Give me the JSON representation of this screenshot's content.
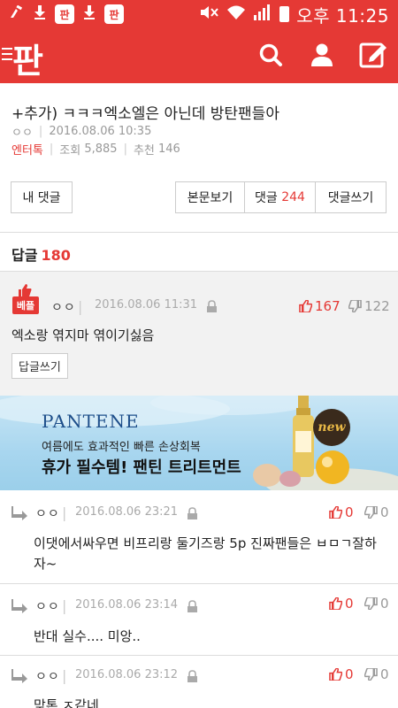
{
  "status_bar": {
    "app_badge_1": "판",
    "app_badge_2": "판",
    "time": "오후 11:25"
  },
  "header": {
    "logo": "판"
  },
  "post": {
    "title": "+추가) ㅋㅋㅋ엑소엘은 아닌데 방탄팬들아",
    "author": "ㅇㅇ",
    "datetime": "2016.08.06 10:35",
    "category": "엔터톡",
    "views_label": "조회",
    "views": "5,885",
    "recommend_label": "추천",
    "recommend": "146"
  },
  "actions": {
    "my_comments": "내 댓글",
    "view_body": "본문보기",
    "comments_label": "댓글",
    "comments_count": "244",
    "write_comment": "댓글쓰기"
  },
  "replies": {
    "label": "답글",
    "count": "180"
  },
  "best_comment": {
    "badge": "베플",
    "author": "ㅇㅇ",
    "datetime": "2016.08.06 11:31",
    "up": "167",
    "down": "122",
    "text": "엑소랑 엮지마 엮이기싫음",
    "reply_button": "답글쓰기"
  },
  "ad": {
    "brand": "PANTENE",
    "subtitle": "여름에도 효과적인 빠른 손상회복",
    "headline": "휴가 필수템! 팬틴 트리트먼트",
    "badge": "new"
  },
  "comments": [
    {
      "author": "ㅇㅇ",
      "datetime": "2016.08.06 23:21",
      "up": "0",
      "down": "0",
      "text_line1": "이댓에서싸우면 비프리랑 둘기즈랑 5p 진짜팬들은 ㅂㅁㄱ잘하",
      "text_line2": "자~"
    },
    {
      "author": "ㅇㅇ",
      "datetime": "2016.08.06 23:14",
      "up": "0",
      "down": "0",
      "text_line1": "반대 실수.... 미앙..",
      "text_line2": ""
    },
    {
      "author": "ㅇㅇ",
      "datetime": "2016.08.06 23:12",
      "up": "0",
      "down": "0",
      "text_line1": "맞톤 ㅈ같네",
      "text_line2": ""
    }
  ],
  "colors": {
    "brand_red": "#e53935",
    "muted": "#999999"
  }
}
